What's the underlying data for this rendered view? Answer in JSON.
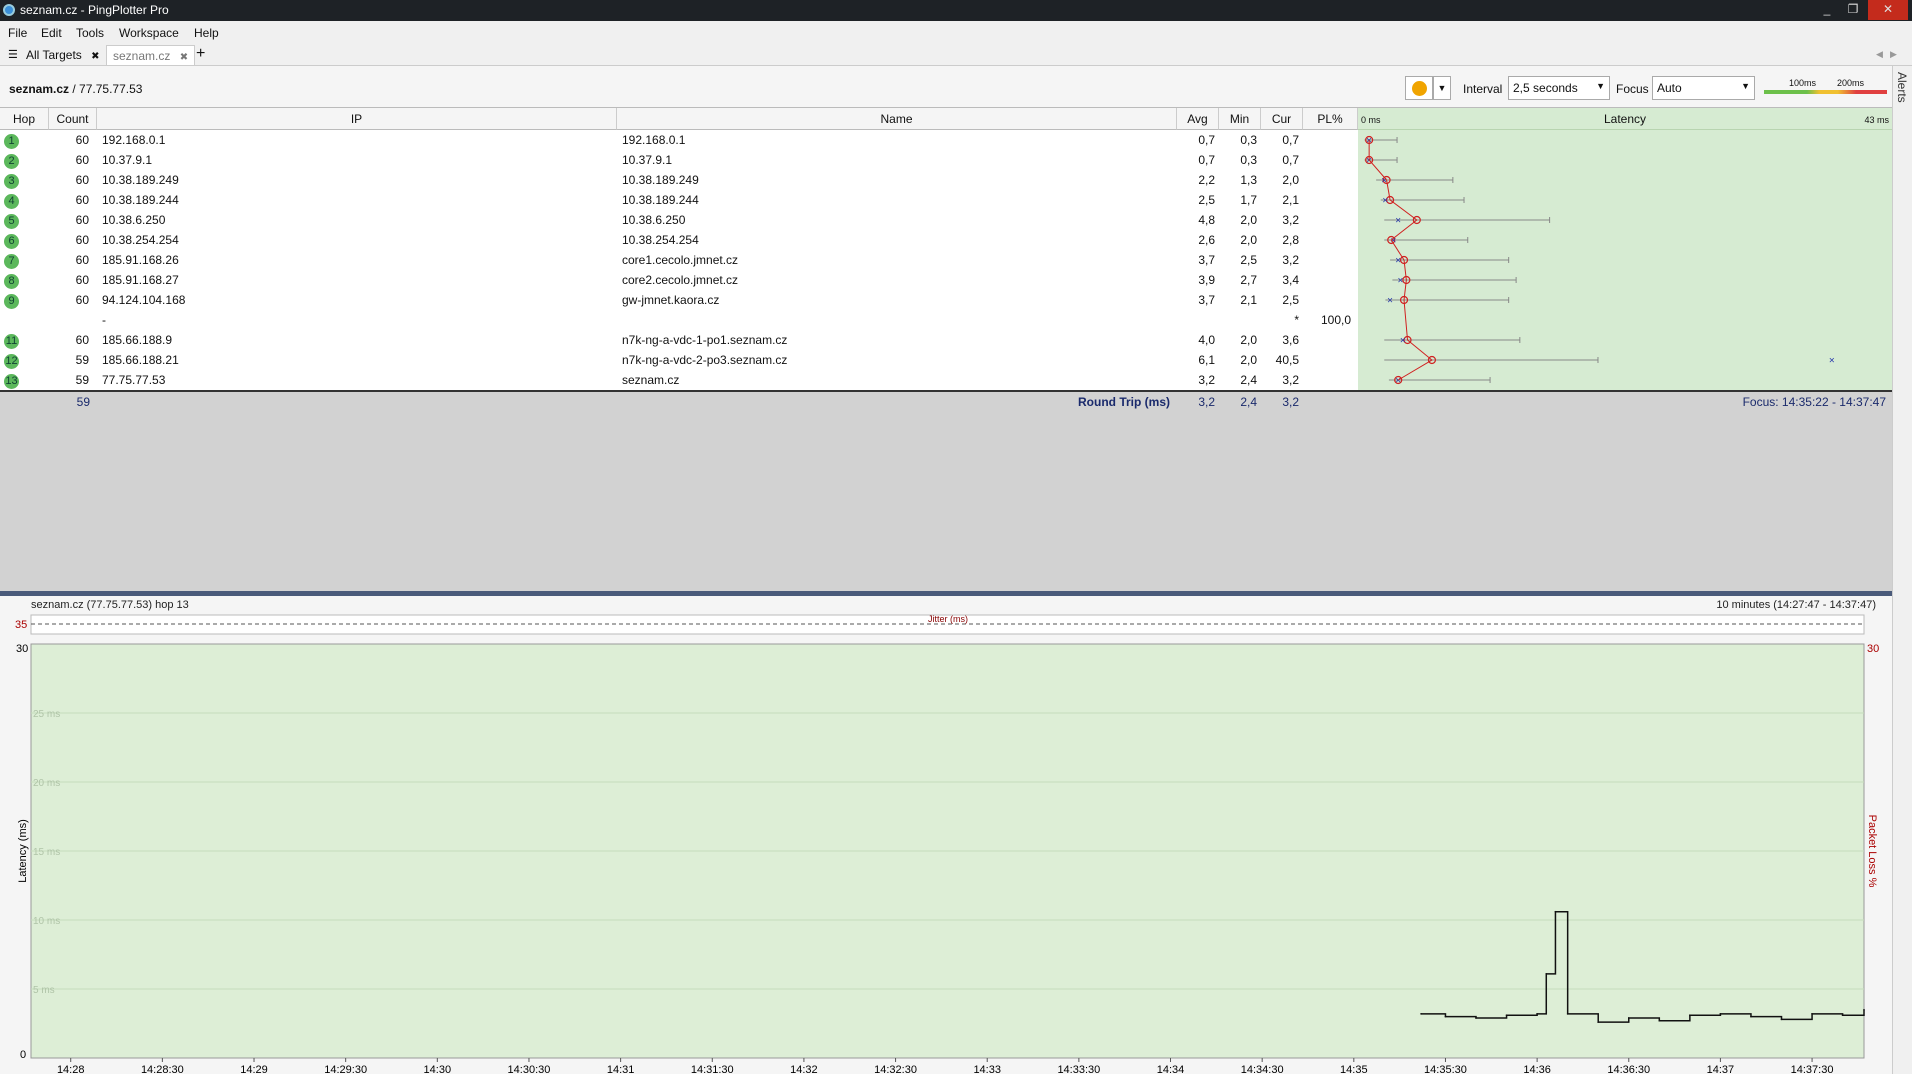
{
  "window": {
    "title": "seznam.cz - PingPlotter Pro",
    "controls": [
      "_",
      "❐",
      "✕"
    ]
  },
  "menu": [
    "File",
    "Edit",
    "Tools",
    "Workspace",
    "Help"
  ],
  "tabs": {
    "all": "All Targets",
    "current": "seznam.cz",
    "add": "+",
    "close": "✖"
  },
  "alerts": "Alerts",
  "target": {
    "name": "seznam.cz",
    "ip": "77.75.77.53"
  },
  "controls": {
    "interval_label": "Interval",
    "interval_value": "2,5 seconds",
    "focus_label": "Focus",
    "focus_value": "Auto",
    "scale_100": "100ms",
    "scale_200": "200ms"
  },
  "columns": {
    "hop": "Hop",
    "count": "Count",
    "ip": "IP",
    "name": "Name",
    "avg": "Avg",
    "min": "Min",
    "cur": "Cur",
    "pl": "PL%",
    "latency": "Latency",
    "lat_min": "0 ms",
    "lat_max": "43 ms"
  },
  "hops": [
    {
      "hop": "1",
      "count": "60",
      "ip": "192.168.0.1",
      "name": "192.168.0.1",
      "avg": "0,7",
      "min": "0,3",
      "cur": "0,7",
      "pl": ""
    },
    {
      "hop": "2",
      "count": "60",
      "ip": "10.37.9.1",
      "name": "10.37.9.1",
      "avg": "0,7",
      "min": "0,3",
      "cur": "0,7",
      "pl": ""
    },
    {
      "hop": "3",
      "count": "60",
      "ip": "10.38.189.249",
      "name": "10.38.189.249",
      "avg": "2,2",
      "min": "1,3",
      "cur": "2,0",
      "pl": ""
    },
    {
      "hop": "4",
      "count": "60",
      "ip": "10.38.189.244",
      "name": "10.38.189.244",
      "avg": "2,5",
      "min": "1,7",
      "cur": "2,1",
      "pl": ""
    },
    {
      "hop": "5",
      "count": "60",
      "ip": "10.38.6.250",
      "name": "10.38.6.250",
      "avg": "4,8",
      "min": "2,0",
      "cur": "3,2",
      "pl": ""
    },
    {
      "hop": "6",
      "count": "60",
      "ip": "10.38.254.254",
      "name": "10.38.254.254",
      "avg": "2,6",
      "min": "2,0",
      "cur": "2,8",
      "pl": ""
    },
    {
      "hop": "7",
      "count": "60",
      "ip": "185.91.168.26",
      "name": "core1.cecolo.jmnet.cz",
      "avg": "3,7",
      "min": "2,5",
      "cur": "3,2",
      "pl": ""
    },
    {
      "hop": "8",
      "count": "60",
      "ip": "185.91.168.27",
      "name": "core2.cecolo.jmnet.cz",
      "avg": "3,9",
      "min": "2,7",
      "cur": "3,4",
      "pl": ""
    },
    {
      "hop": "9",
      "count": "60",
      "ip": "94.124.104.168",
      "name": "gw-jmnet.kaora.cz",
      "avg": "3,7",
      "min": "2,1",
      "cur": "2,5",
      "pl": ""
    },
    {
      "hop": "",
      "count": "",
      "ip": "-",
      "name": "",
      "avg": "",
      "min": "",
      "cur": "*",
      "pl": "100,0"
    },
    {
      "hop": "11",
      "count": "60",
      "ip": "185.66.188.9",
      "name": "n7k-ng-a-vdc-1-po1.seznam.cz",
      "avg": "4,0",
      "min": "2,0",
      "cur": "3,6",
      "pl": ""
    },
    {
      "hop": "12",
      "count": "59",
      "ip": "185.66.188.21",
      "name": "n7k-ng-a-vdc-2-po3.seznam.cz",
      "avg": "6,1",
      "min": "2,0",
      "cur": "40,5",
      "pl": ""
    },
    {
      "hop": "13",
      "count": "59",
      "ip": "77.75.77.53",
      "name": "seznam.cz",
      "avg": "3,2",
      "min": "2,4",
      "cur": "3,2",
      "pl": ""
    }
  ],
  "summary": {
    "count": "59",
    "label": "Round Trip (ms)",
    "avg": "3,2",
    "min": "2,4",
    "cur": "3,2",
    "focus": "Focus: 14:35:22 - 14:37:47"
  },
  "graph": {
    "title": "seznam.cz (77.75.77.53) hop 13",
    "range": "10 minutes (14:27:47 - 14:37:47)",
    "jitter_label": "Jitter (ms)",
    "jitter_max": "35",
    "y_max": "30",
    "y_min": "0",
    "pl_max": "30",
    "y_label": "Latency (ms)",
    "pl_label": "Packet Loss %",
    "grid_labels": [
      "25 ms",
      "20 ms",
      "15 ms",
      "10 ms",
      "5 ms"
    ],
    "x_labels": [
      "14:28",
      "14:28:30",
      "14:29",
      "14:29:30",
      "14:30",
      "14:30:30",
      "14:31",
      "14:31:30",
      "14:32",
      "14:32:30",
      "14:33",
      "14:33:30",
      "14:34",
      "14:34:30",
      "14:35",
      "14:35:30",
      "14:36",
      "14:36:30",
      "14:37",
      "14:37:30"
    ]
  },
  "chart_data": {
    "type": "line",
    "ylabel": "Latency (ms)",
    "ylim": [
      0,
      30
    ],
    "xlim": [
      "14:27:47",
      "14:37:47"
    ],
    "series": [
      {
        "x": [
          "14:35:22",
          "14:35:30",
          "14:35:40",
          "14:35:50",
          "14:36:00",
          "14:36:03",
          "14:36:06",
          "14:36:10",
          "14:36:20",
          "14:36:30",
          "14:36:40",
          "14:36:50",
          "14:37:00",
          "14:37:10",
          "14:37:20",
          "14:37:30",
          "14:37:40",
          "14:37:47"
        ],
        "values": [
          3.2,
          3.0,
          2.9,
          3.1,
          3.2,
          6.1,
          10.6,
          3.2,
          2.6,
          2.9,
          2.7,
          3.1,
          3.2,
          3.0,
          2.8,
          3.2,
          3.1,
          3.5
        ]
      }
    ]
  }
}
